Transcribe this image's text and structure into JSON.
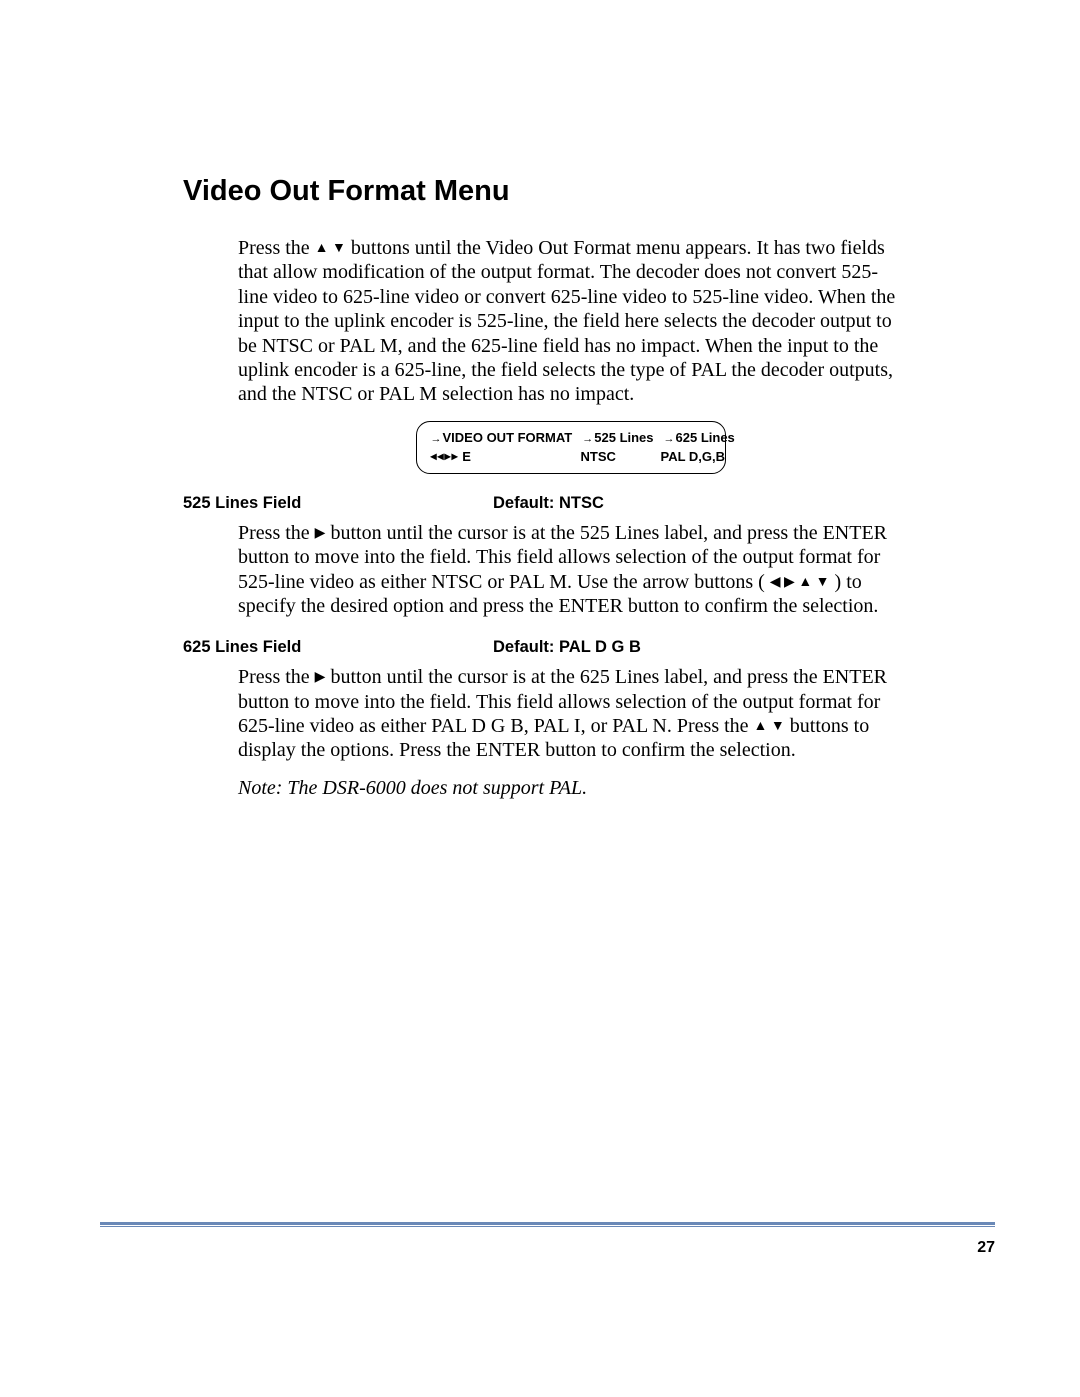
{
  "title": "Video Out Format Menu",
  "intro": {
    "part1": "Press the ",
    "up_down_glyph": "▲  ▼",
    "part2": " buttons until the Video Out Format menu appears. It has two fields that allow modification of the output format. The decoder does not convert 525-line video to 625-line video or convert 625-line video to 525-line video. When the input to the uplink encoder is 525-line, the field here selects the decoder output to be NTSC or PAL M, and the 625-line field has no impact. When the input to the uplink encoder is a 625-line, the field selects the type of PAL the decoder outputs, and the NTSC or PAL M selection has no impact."
  },
  "lcd": {
    "row1": {
      "c1": "VIDEO OUT FORMAT",
      "c2": "525 Lines",
      "c3": "625 Lines",
      "arrow": "→"
    },
    "row2": {
      "c1_glyphs": "◂◂▸▸",
      "c1_e": " E",
      "c2": "NTSC",
      "c3": "PAL D,G,B"
    }
  },
  "field525": {
    "label": "525 Lines Field",
    "default": "Default: NTSC",
    "p1a": "Press the ",
    "right_glyph": "▶",
    "p1b": " button until the cursor is at the 525 Lines label, and press the ENTER button to move into the field. This field allows selection of the output format for 525-line video as either NTSC or PAL M. Use the arrow buttons ( ",
    "arrows_glyph": "◀  ▶  ▲  ▼",
    "p1c": " ) to specify the desired option and press the ENTER button to confirm the selection."
  },
  "field625": {
    "label": "625 Lines Field",
    "default": "Default: PAL D G B",
    "p1a": "Press the ",
    "right_glyph": "▶",
    "p1b": " button until the cursor is at the 625 Lines label, and press the ENTER button to move into the field. This field allows selection of the output format for 625-line video as either PAL D G B, PAL I, or PAL N. Press the ",
    "updown_glyph": "▲  ▼",
    "p1c": " buttons to display the options. Press the ENTER button to confirm the selection."
  },
  "note": "Note:  The DSR-6000 does not support PAL.",
  "page_number": "27"
}
